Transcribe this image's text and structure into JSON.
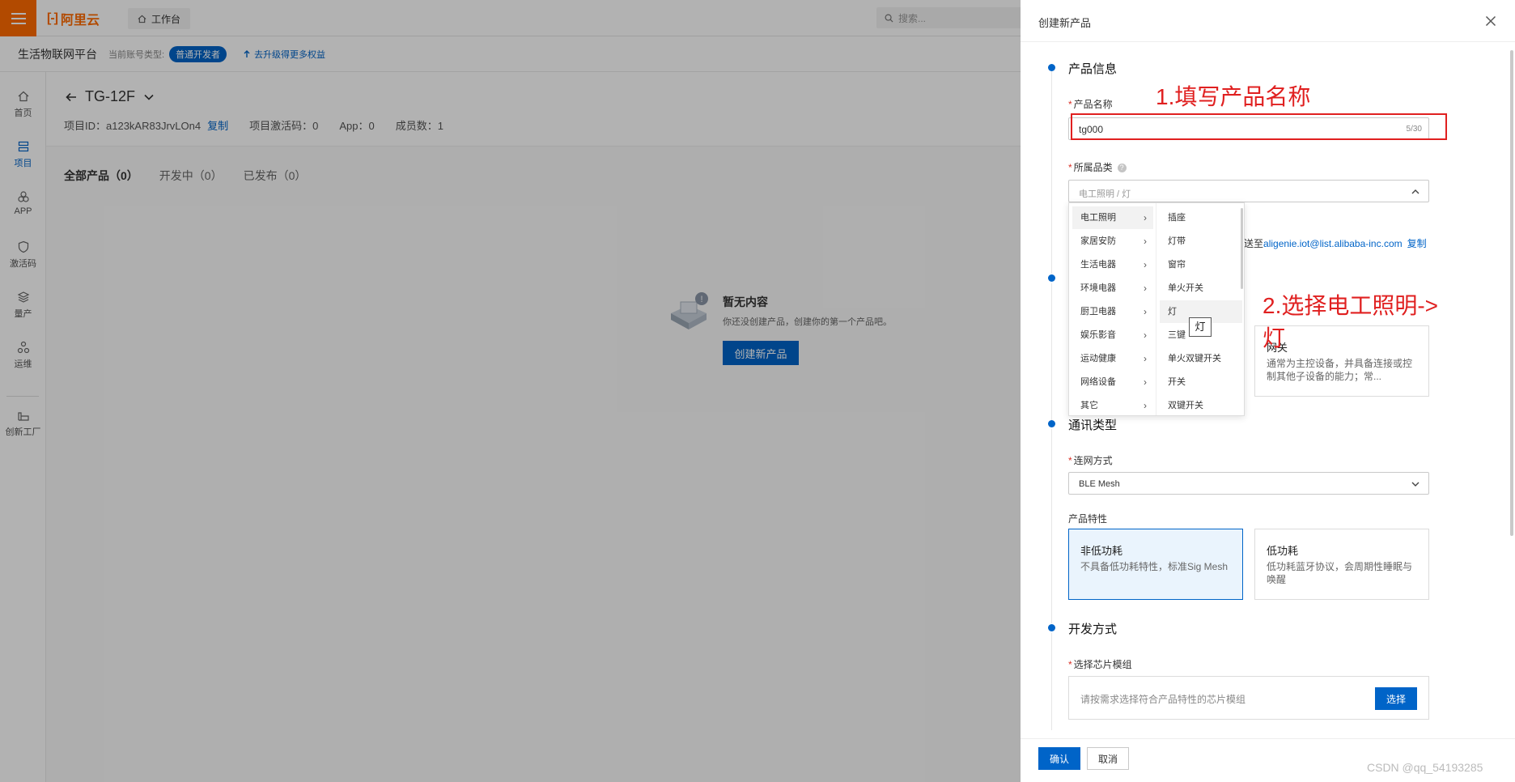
{
  "topbar": {
    "logo_text": "阿里云",
    "workspace_label": "工作台",
    "search_placeholder": "搜索..."
  },
  "subbar": {
    "platform": "生活物联网平台",
    "account_type_label": "当前账号类型:",
    "account_badge": "普通开发者",
    "upgrade_link": "去升级得更多权益"
  },
  "sidebar": {
    "items": [
      {
        "label": "首页",
        "icon": "home-icon"
      },
      {
        "label": "项目",
        "icon": "project-icon"
      },
      {
        "label": "APP",
        "icon": "app-icon"
      },
      {
        "label": "激活码",
        "icon": "activation-icon"
      },
      {
        "label": "量产",
        "icon": "mass-production-icon"
      },
      {
        "label": "运维",
        "icon": "ops-icon"
      },
      {
        "label": "创新工厂",
        "icon": "factory-icon"
      }
    ]
  },
  "project": {
    "name": "TG-12F",
    "id_text": "项目ID：a123kAR83JrvLOn4",
    "copy": "复制",
    "activation_code": "项目激活码：0",
    "app_count": "App：0",
    "member_count": "成员数：1",
    "tabs": [
      "全部产品（0）",
      "开发中（0）",
      "已发布（0）"
    ]
  },
  "empty_state": {
    "title": "暂无内容",
    "desc": "你还没创建产品，创建你的第一个产品吧。",
    "button": "创建新产品"
  },
  "drawer": {
    "title": "创建新产品",
    "sections": {
      "product_info": "产品信息",
      "comm_type": "通讯类型",
      "dev_method": "开发方式"
    },
    "product_name_label": "产品名称",
    "product_name_value": "tg000",
    "product_name_count": "5/30",
    "category_label": "所属品类",
    "category_value": "电工照明 / 灯",
    "email_prefix": "送至",
    "email": "aligenie.iot@list.alibaba-inc.com",
    "email_copy": "复制",
    "gateway_card": {
      "title": "网关",
      "desc": "通常为主控设备，并具备连接或控制其他子设备的能力；常..."
    },
    "network_label": "连网方式",
    "network_value": "BLE Mesh",
    "feature_label": "产品特性",
    "feature_cards": [
      {
        "title": "非低功耗",
        "desc": "不具备低功耗特性，标准Sig Mesh",
        "selected": true
      },
      {
        "title": "低功耗",
        "desc": "低功耗蓝牙协议，会周期性睡眠与唤醒",
        "selected": false
      }
    ],
    "chip_label": "选择芯片模组",
    "chip_placeholder": "请按需求选择符合产品特性的芯片模组",
    "chip_button": "选择",
    "ok_button": "确认",
    "cancel_button": "取消"
  },
  "cascader": {
    "level1": [
      "电工照明",
      "家居安防",
      "生活电器",
      "环境电器",
      "厨卫电器",
      "娱乐影音",
      "运动健康",
      "网络设备",
      "其它"
    ],
    "level2": [
      "插座",
      "灯带",
      "窗帘",
      "单火开关",
      "灯",
      "三键",
      "单火双键开关",
      "开关",
      "双键开关"
    ],
    "tooltip": "灯"
  },
  "annotations": {
    "step1": "1.填写产品名称",
    "step2_line1": "2.选择电工照明->",
    "step2_line2": "灯"
  },
  "watermark": "CSDN @qq_54193285",
  "colors": {
    "brand_orange": "#ff6a00",
    "primary_blue": "#0064c8",
    "annotation_red": "#e02020"
  }
}
